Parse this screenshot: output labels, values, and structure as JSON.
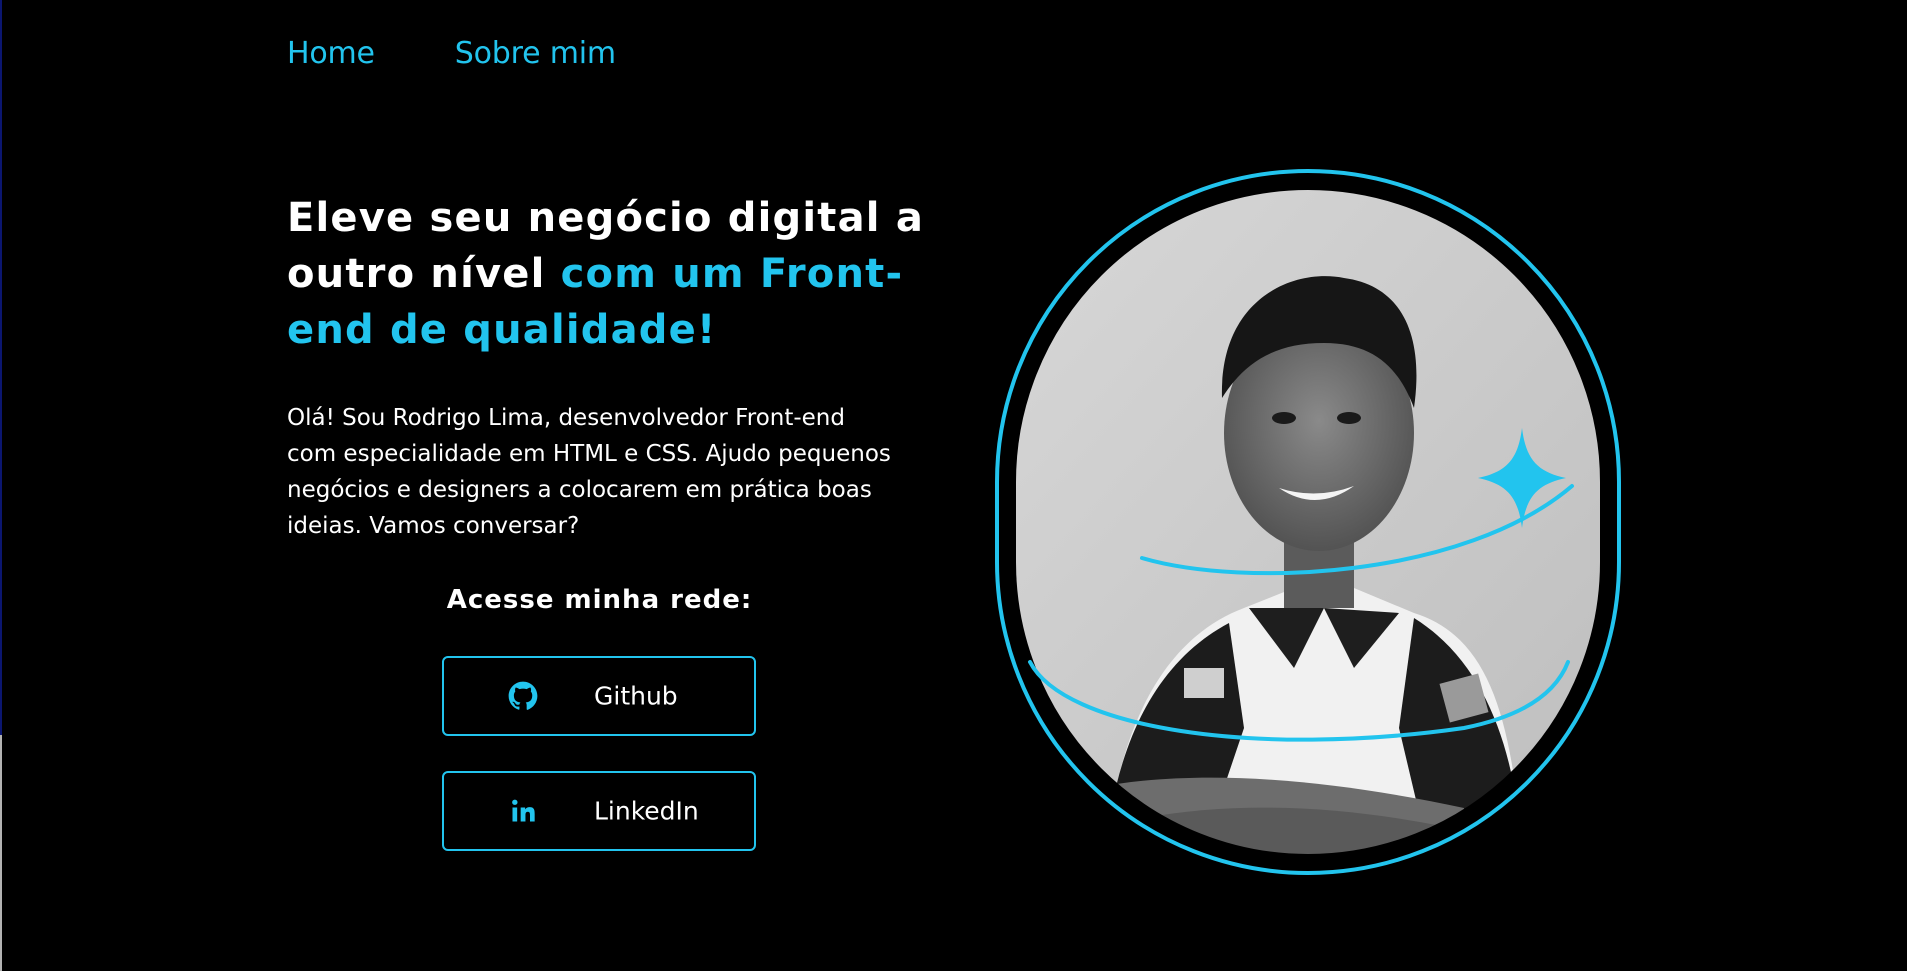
{
  "nav": {
    "home": "Home",
    "about": "Sobre mim"
  },
  "hero": {
    "headline_white": "Eleve seu negócio digital a outro nível ",
    "headline_accent": "com um Front-end de qualidade!",
    "intro": "Olá! Sou Rodrigo Lima, desenvolvedor Front-end com especialidade em HTML e CSS. Ajudo pequenos negócios e designers a colocarem em prática boas ideias. Vamos conversar?"
  },
  "network": {
    "title": "Acesse minha rede:",
    "github_label": "Github",
    "github_icon": "github-icon",
    "linkedin_label": "LinkedIn",
    "linkedin_icon": "linkedin-icon"
  },
  "colors": {
    "background": "#000000",
    "accent": "#22c4ee",
    "text": "#ffffff"
  }
}
